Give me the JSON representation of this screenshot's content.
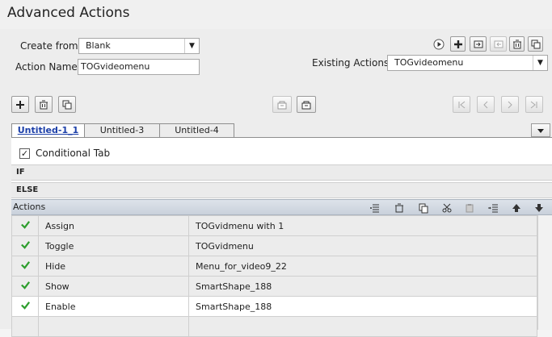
{
  "window": {
    "title": "Advanced Actions"
  },
  "form": {
    "create_from_label": "Create from:",
    "create_from_value": "Blank",
    "action_name_label": "Action Name:",
    "action_name_value": "TOGvideomenu",
    "existing_actions_label": "Existing Actions:",
    "existing_actions_value": "TOGvideomenu"
  },
  "tabs": [
    {
      "label": "Untitled-1_1",
      "active": true
    },
    {
      "label": "Untitled-3",
      "active": false
    },
    {
      "label": "Untitled-4",
      "active": false
    }
  ],
  "conditional_tab": {
    "label": "Conditional Tab",
    "checked": true,
    "check_glyph": "✓"
  },
  "sections": {
    "if_label": "IF",
    "else_label": "ELSE"
  },
  "actions": {
    "header": "Actions",
    "rows": [
      {
        "action": "Assign",
        "target": "TOGvidmenu   with   1"
      },
      {
        "action": "Toggle",
        "target": "TOGvidmenu"
      },
      {
        "action": "Hide",
        "target": "Menu_for_video9_22"
      },
      {
        "action": "Show",
        "target": "SmartShape_188"
      },
      {
        "action": "Enable",
        "target": "SmartShape_188"
      },
      {
        "action": "",
        "target": ""
      }
    ]
  },
  "colors": {
    "check_green": "#2e9e2e",
    "active_tab_text": "#1c3fa8",
    "header_band": "#c9d1db"
  }
}
